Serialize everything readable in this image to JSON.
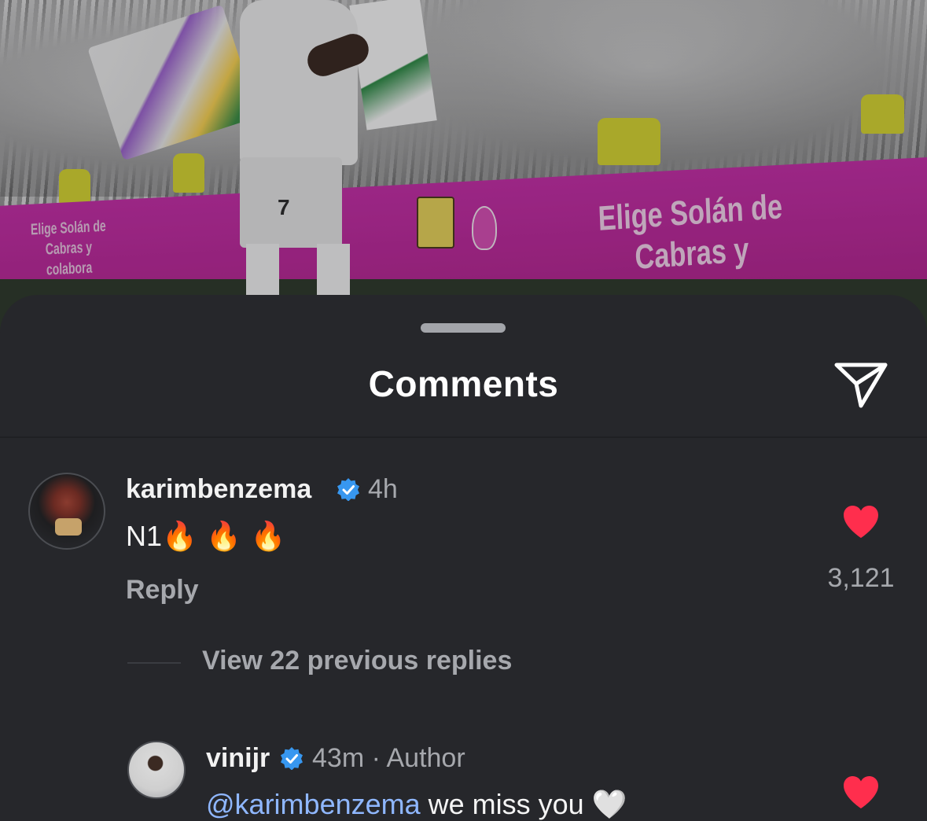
{
  "photo": {
    "board_text": "Elige Solán de Cabras y colabora",
    "board_text_left": "Elige Solán de Cabras y colabora",
    "jersey_number": "7"
  },
  "sheet": {
    "title": "Comments",
    "share_icon": "paper-plane-icon"
  },
  "comments": [
    {
      "username": "karimbenzema",
      "verified": true,
      "time": "4h",
      "text": "N1",
      "emoji": "🔥 🔥 🔥",
      "reply_label": "Reply",
      "likes": "3,121",
      "liked": true,
      "view_replies": "View 22 previous replies"
    }
  ],
  "replies": [
    {
      "username": "vinijr",
      "verified": true,
      "time": "43m · Author",
      "mention": "@karimbenzema",
      "text": " we miss you",
      "emoji": "🤍",
      "liked": true
    }
  ],
  "colors": {
    "background": "#26272b",
    "heart": "#ff2e4d",
    "verified": "#3797f0",
    "mention": "#8fb7ff"
  }
}
